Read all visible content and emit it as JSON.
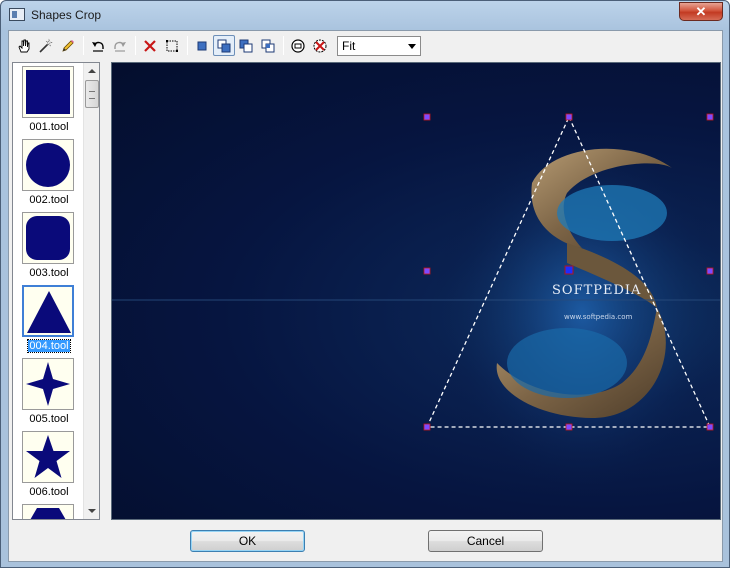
{
  "window": {
    "title": "Shapes Crop",
    "close_label": "✕"
  },
  "toolbar": {
    "buttons": [
      {
        "name": "pan-tool-icon"
      },
      {
        "name": "magic-wand-icon"
      },
      {
        "name": "pencil-icon"
      },
      {
        "name": "undo-icon"
      },
      {
        "name": "redo-icon"
      },
      {
        "name": "delete-icon"
      },
      {
        "name": "select-all-icon"
      },
      {
        "name": "shape-mode-replace-icon"
      },
      {
        "name": "shape-mode-add-icon"
      },
      {
        "name": "shape-mode-subtract-icon"
      },
      {
        "name": "shape-mode-intersect-icon"
      },
      {
        "name": "center-icon"
      },
      {
        "name": "clear-icon"
      }
    ],
    "zoom": {
      "selected": "Fit"
    }
  },
  "shapes": [
    {
      "label": "001.tool",
      "shape": "square"
    },
    {
      "label": "002.tool",
      "shape": "circle"
    },
    {
      "label": "003.tool",
      "shape": "rounded-square"
    },
    {
      "label": "004.tool",
      "shape": "triangle",
      "selected": true
    },
    {
      "label": "005.tool",
      "shape": "four-point-star"
    },
    {
      "label": "006.tool",
      "shape": "star"
    }
  ],
  "canvas": {
    "watermark": "SOFTPEDIA",
    "url_text": "www.softpedia.com",
    "selection_shape": "triangle"
  },
  "buttons": {
    "ok_label": "OK",
    "cancel_label": "Cancel"
  },
  "colors": {
    "shape_fill": "#0a0a7a",
    "canvas_bg": "#051236",
    "handle": "#7d4bff"
  }
}
